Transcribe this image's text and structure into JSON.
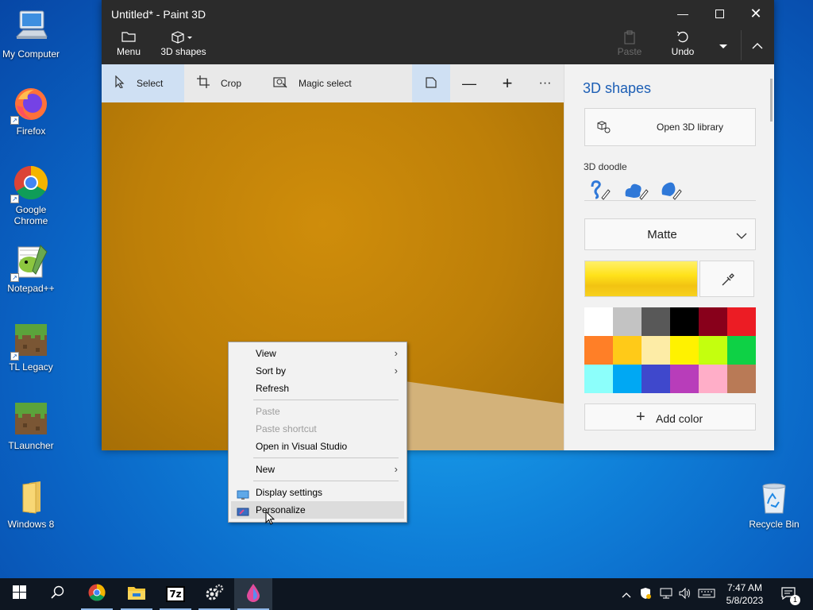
{
  "desktop": {
    "icons": [
      {
        "label": "My Computer",
        "icon": "computer-icon"
      },
      {
        "label": "Firefox",
        "icon": "firefox-icon"
      },
      {
        "label": "Google Chrome",
        "icon": "chrome-icon"
      },
      {
        "label": "Notepad++",
        "icon": "notepadpp-icon"
      },
      {
        "label": "TL Legacy",
        "icon": "minecraft-block-icon"
      },
      {
        "label": "TLauncher",
        "icon": "minecraft-block-icon"
      },
      {
        "label": "Windows 8",
        "icon": "folder-icon"
      },
      {
        "label": "Recycle Bin",
        "icon": "recycle-bin-icon"
      }
    ]
  },
  "window": {
    "title": "Untitled* - Paint 3D",
    "menu_label": "Menu",
    "shapes_label": "3D shapes",
    "paste_label": "Paste",
    "undo_label": "Undo"
  },
  "toolbar": {
    "select_label": "Select",
    "crop_label": "Crop",
    "magic_select_label": "Magic select"
  },
  "panel": {
    "title": "3D shapes",
    "open_library_label": "Open 3D library",
    "doodle_label": "3D doodle",
    "material_value": "Matte",
    "current_color": "#f7d11e",
    "palette": [
      "#ffffff",
      "#c3c3c3",
      "#585858",
      "#000000",
      "#88001b",
      "#ec1c24",
      "#ff7f27",
      "#ffca18",
      "#fdeca6",
      "#fff200",
      "#c4ff0e",
      "#0ed145",
      "#8cfffb",
      "#00a8f3",
      "#3f48cc",
      "#b83dba",
      "#ffaec8",
      "#b97a56"
    ],
    "add_color_label": "Add color"
  },
  "context_menu": {
    "items": [
      {
        "label": "View",
        "submenu": true,
        "enabled": true
      },
      {
        "label": "Sort by",
        "submenu": true,
        "enabled": true
      },
      {
        "label": "Refresh",
        "submenu": false,
        "enabled": true
      },
      {
        "label": "Paste",
        "submenu": false,
        "enabled": false
      },
      {
        "label": "Paste shortcut",
        "submenu": false,
        "enabled": false
      },
      {
        "label": "Open in Visual Studio",
        "submenu": false,
        "enabled": true
      },
      {
        "label": "New",
        "submenu": true,
        "enabled": true
      },
      {
        "label": "Display settings",
        "submenu": false,
        "enabled": true
      },
      {
        "label": "Personalize",
        "submenu": false,
        "enabled": true,
        "highlighted": true
      }
    ]
  },
  "taskbar": {
    "time": "7:47 AM",
    "date": "5/8/2023",
    "notification_count": "1",
    "apps": [
      "start-icon",
      "search-icon",
      "chrome-icon",
      "file-explorer-icon",
      "7zip-icon",
      "settings-app-icon",
      "paint3d-icon"
    ]
  }
}
